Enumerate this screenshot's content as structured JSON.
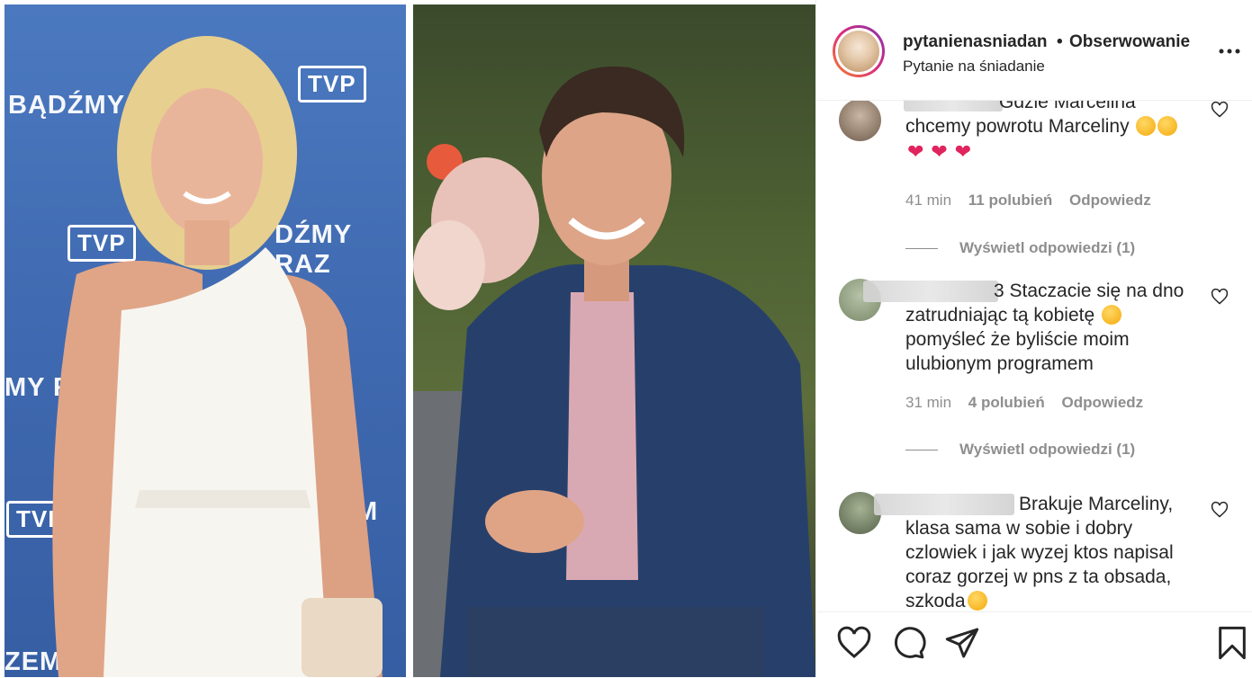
{
  "post": {
    "username": "pytanienasniadan",
    "separator": "•",
    "follow_status": "Obserwowanie",
    "subtitle": "Pytanie na śniadanie"
  },
  "photo": {
    "backdrop_texts": [
      "BĄDŹMY R",
      "DŹMY RAZ",
      "MY R",
      "ZEM",
      "M"
    ],
    "logo_text": "TVP"
  },
  "comments": [
    {
      "text": "Gdzie Marcelina chcemy powrotu Marceliny",
      "emojis_after_text": 2,
      "hearts": [
        "❤",
        "❤",
        "❤"
      ],
      "time": "41 min",
      "likes": "11 polubień",
      "reply": "Odpowiedz",
      "view_replies": "Wyświetl odpowiedzi (1)"
    },
    {
      "text_lines": [
        "3 Staczacie się na dno",
        "zatrudniając tą kobietę",
        "pomyśleć że byliście moim",
        "ulubionym programem"
      ],
      "time": "31 min",
      "likes": "4 polubień",
      "reply": "Odpowiedz",
      "view_replies": "Wyświetl odpowiedzi (1)"
    },
    {
      "text_lines": [
        "Brakuje Marceliny,",
        "klasa sama w sobie i dobry",
        "czlowiek i jak wyzej ktos napisal",
        "coraz gorzej w pns z ta obsada,",
        "szkoda"
      ]
    }
  ],
  "icons": {
    "more": "more-horizontal-icon",
    "comment_like": "heart-outline-icon",
    "like": "heart-outline-icon",
    "comment": "comment-bubble-icon",
    "share": "send-icon",
    "save": "bookmark-icon"
  },
  "colors": {
    "text": "#262626",
    "muted": "#8e8e8e",
    "divider": "#efefef",
    "heart_emoji": "#e0245e"
  }
}
